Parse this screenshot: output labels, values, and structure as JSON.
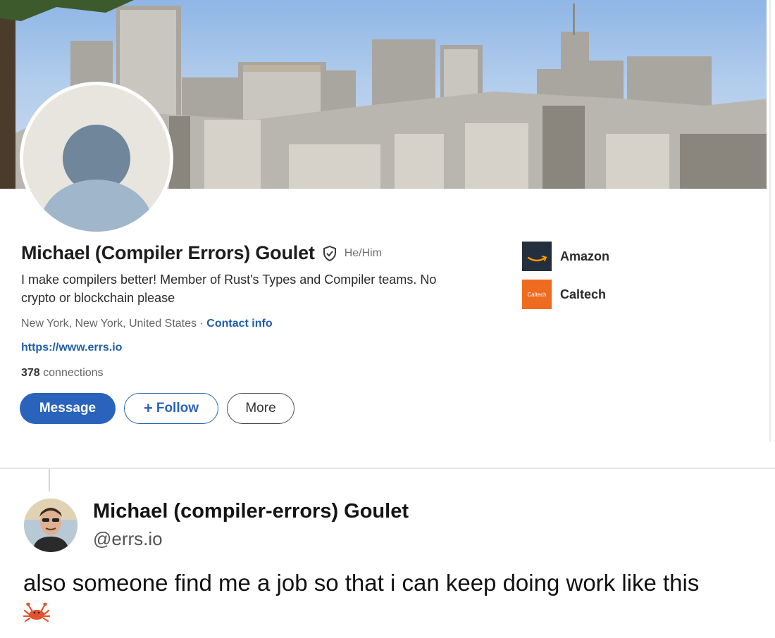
{
  "profile": {
    "name": "Michael (Compiler Errors) Goulet",
    "pronouns": "He/Him",
    "headline": "I make compilers better! Member of Rust's Types and Compiler teams. No crypto or blockchain please",
    "location": "New York, New York, United States",
    "separator": "·",
    "contact_info": "Contact info",
    "website": "https://www.errs.io",
    "connections_count": "378",
    "connections_label": "connections",
    "buttons": {
      "message": "Message",
      "follow_plus": "+",
      "follow": "Follow",
      "more": "More"
    },
    "organizations": [
      {
        "name": "Amazon",
        "logo": "amazon-logo"
      },
      {
        "name": "Caltech",
        "logo": "caltech-logo",
        "logo_text": "Caltech"
      }
    ],
    "icons": {
      "verified": "verified-shield-icon",
      "avatar": "default-avatar-icon"
    },
    "colors": {
      "accent": "#2a63bb",
      "link": "#1f5ea8",
      "amazon_bg": "#232f3e",
      "caltech_bg": "#ef6b1f"
    }
  },
  "tweet": {
    "author": "Michael (compiler-errors) Goulet",
    "handle": "@errs.io",
    "text": "also someone find me a job so that i can keep doing work like this",
    "emoji": "crab-icon"
  }
}
